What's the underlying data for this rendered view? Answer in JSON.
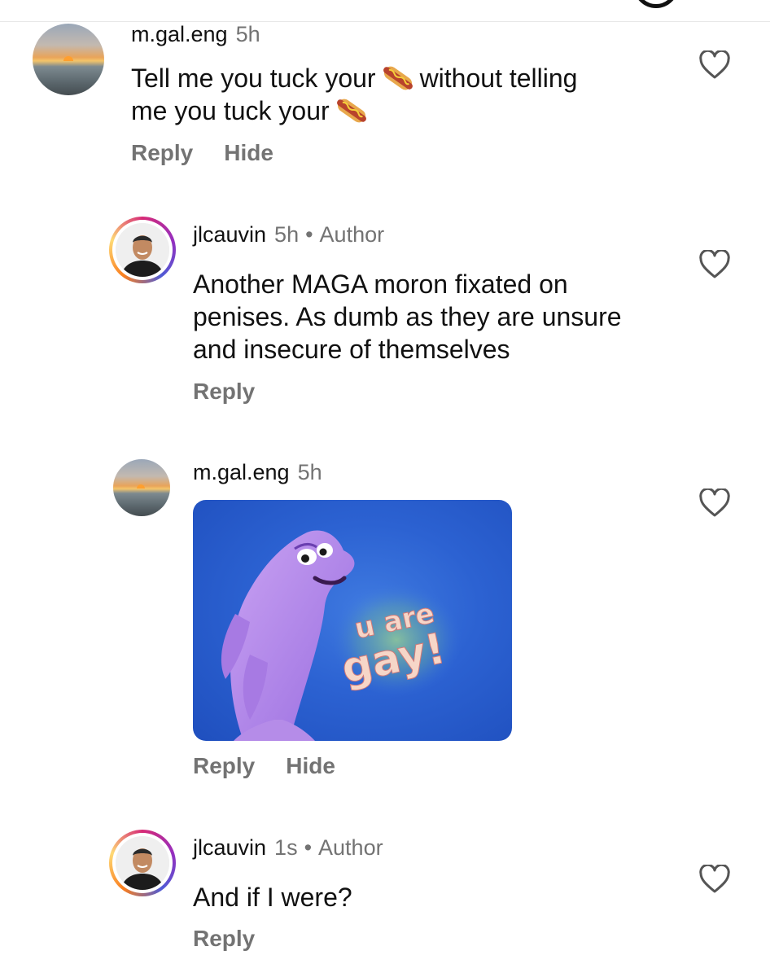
{
  "comments": [
    {
      "username": "m.gal.eng",
      "time": "5h",
      "text_line1_a": "Tell me you tuck your",
      "text_line1_b": "without telling",
      "text_line2_a": "me you tuck your",
      "emoji": "hotdog-emoji",
      "actions": [
        "Reply",
        "Hide"
      ]
    },
    {
      "username": "jlcauvin",
      "time": "5h",
      "author_label": "Author",
      "lines": [
        "Another MAGA moron fixated on",
        "penises. As dumb as they are unsure",
        "and insecure of themselves"
      ],
      "actions": [
        "Reply"
      ]
    },
    {
      "username": "m.gal.eng",
      "time": "5h",
      "gif_text_line1": "u are",
      "gif_text_line2": "gay!",
      "actions": [
        "Reply",
        "Hide"
      ]
    },
    {
      "username": "jlcauvin",
      "time": "1s",
      "author_label": "Author",
      "text": "And if I were?",
      "actions": [
        "Reply"
      ]
    }
  ],
  "colors": {
    "secondary_text": "#737373",
    "primary_text": "#111111",
    "gif_background": "#2c62d2",
    "dolphin": "#b98ee8"
  },
  "icons": {
    "like": "heart-outline-icon"
  }
}
